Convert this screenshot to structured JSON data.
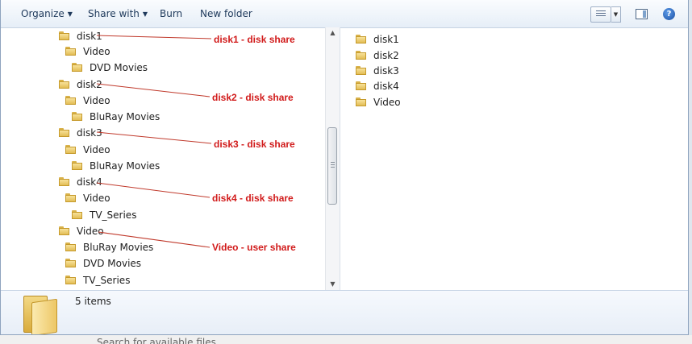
{
  "toolbar": {
    "organize": "Organize",
    "share_with": "Share with",
    "burn": "Burn",
    "new_folder": "New folder"
  },
  "nav_tree": [
    {
      "label": "disk1",
      "icon": "folder-icon"
    },
    {
      "label": "Video",
      "icon": "folder-icon"
    },
    {
      "label": "DVD Movies",
      "icon": "folder-icon"
    },
    {
      "label": "disk2",
      "icon": "folder-icon"
    },
    {
      "label": "Video",
      "icon": "folder-icon"
    },
    {
      "label": "BluRay Movies",
      "icon": "folder-icon"
    },
    {
      "label": "disk3",
      "icon": "folder-icon"
    },
    {
      "label": "Video",
      "icon": "folder-icon"
    },
    {
      "label": "BluRay Movies",
      "icon": "folder-icon"
    },
    {
      "label": "disk4",
      "icon": "folder-icon"
    },
    {
      "label": "Video",
      "icon": "folder-icon"
    },
    {
      "label": "TV_Series",
      "icon": "folder-icon"
    },
    {
      "label": "Video",
      "icon": "folder-icon"
    },
    {
      "label": "BluRay Movies",
      "icon": "folder-icon"
    },
    {
      "label": "DVD Movies",
      "icon": "folder-icon"
    },
    {
      "label": "TV_Series",
      "icon": "folder-icon"
    }
  ],
  "annotations": [
    "disk1 - disk share",
    "disk2 - disk share",
    "disk3 - disk share",
    "disk4 - disk share",
    "Video - user share"
  ],
  "content_items": [
    "disk1",
    "disk2",
    "disk3",
    "disk4",
    "Video"
  ],
  "details": {
    "count": "5 items"
  },
  "bottom_partial_text": "Search for available files",
  "colors": {
    "annotation": "#d11a1a",
    "toolbar_text": "#1e395b",
    "folder": "#e2bd55"
  }
}
